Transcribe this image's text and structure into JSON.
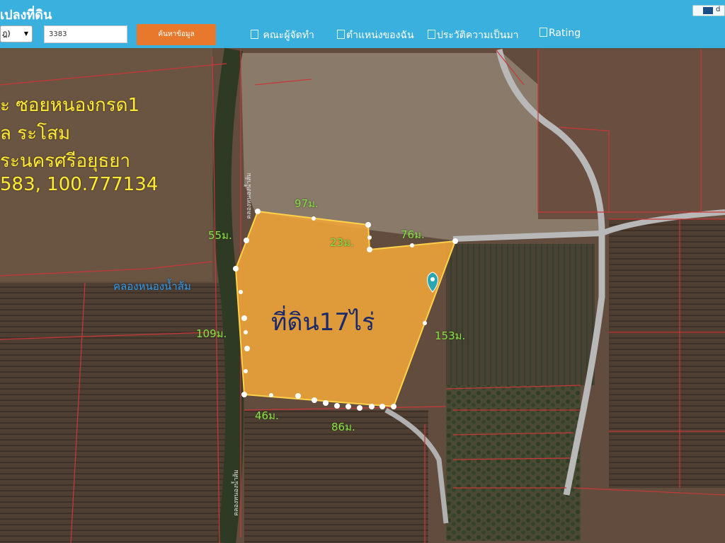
{
  "header": {
    "title": "เปลงที่ดิน",
    "corner_label": "d",
    "select_value": "ฎ)",
    "search_value": "3383",
    "search_button": "ค้นหาข้อมูล",
    "checkboxes": [
      "คณะผู้จัดทำ",
      "ตำแหน่งของฉัน",
      "ประวัติความเป็นมา",
      "Rating"
    ]
  },
  "map": {
    "info_lines": [
      "ะ ซอยหนองกรด1",
      "ล ระโสม",
      "ระนครศรีอยุธยา",
      "583, 100.777134"
    ],
    "plot_label": "ที่ดิน17ไร่",
    "canal_label": "คลองหนองน้ำส้ม",
    "road_label_top": "คลองหนองน้ำส้ม",
    "road_label_bottom": "คลองหนองน้ำส้ม",
    "measurements": {
      "top": "97ม.",
      "left_top": "55ม.",
      "notch": "23ม.",
      "right_top": "76ม.",
      "left": "109ม.",
      "right": "153ม.",
      "bottom_left": "46ม.",
      "bottom": "86ม."
    },
    "colors": {
      "plot_fill": "#f0a53a",
      "plot_edge": "#ffd24a",
      "parcel_lines": "#c8383a",
      "measure": "#8ae04a",
      "info": "#ffea3a",
      "pin": "#2aa6b0"
    }
  }
}
